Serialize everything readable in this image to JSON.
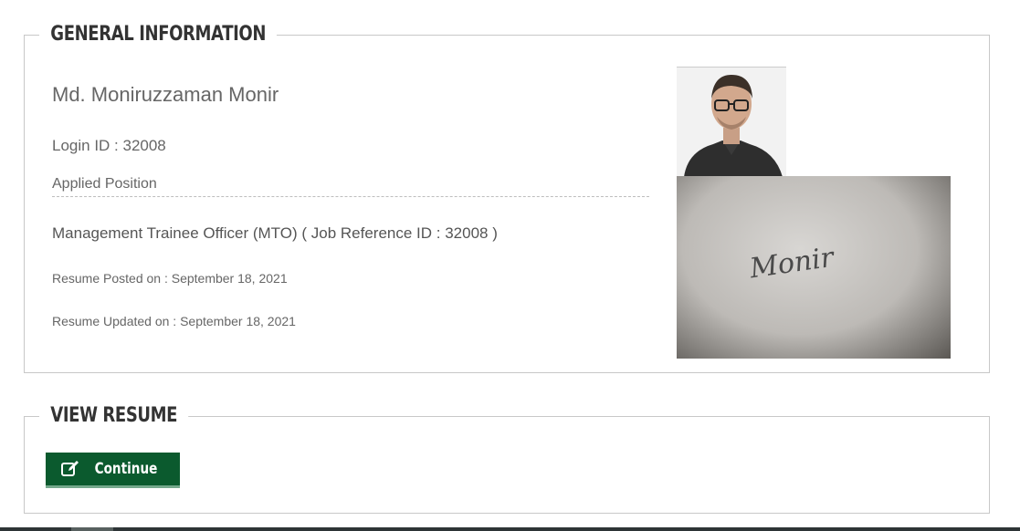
{
  "general": {
    "legend": "GENERAL INFORMATION",
    "name": "Md. Moniruzzaman Monir",
    "login": "Login ID : 32008",
    "applied_label": "Applied Position",
    "position": "Management Trainee Officer (MTO) ( Job Reference ID : 32008 )",
    "posted": "Resume Posted on : September 18, 2021",
    "updated": "Resume Updated on : September 18, 2021",
    "signature_text": "Monir"
  },
  "resume": {
    "legend": "VIEW RESUME",
    "continue_label": "Continue"
  },
  "colors": {
    "button_bg": "#0b5a2e",
    "button_border": "#74a88b"
  }
}
